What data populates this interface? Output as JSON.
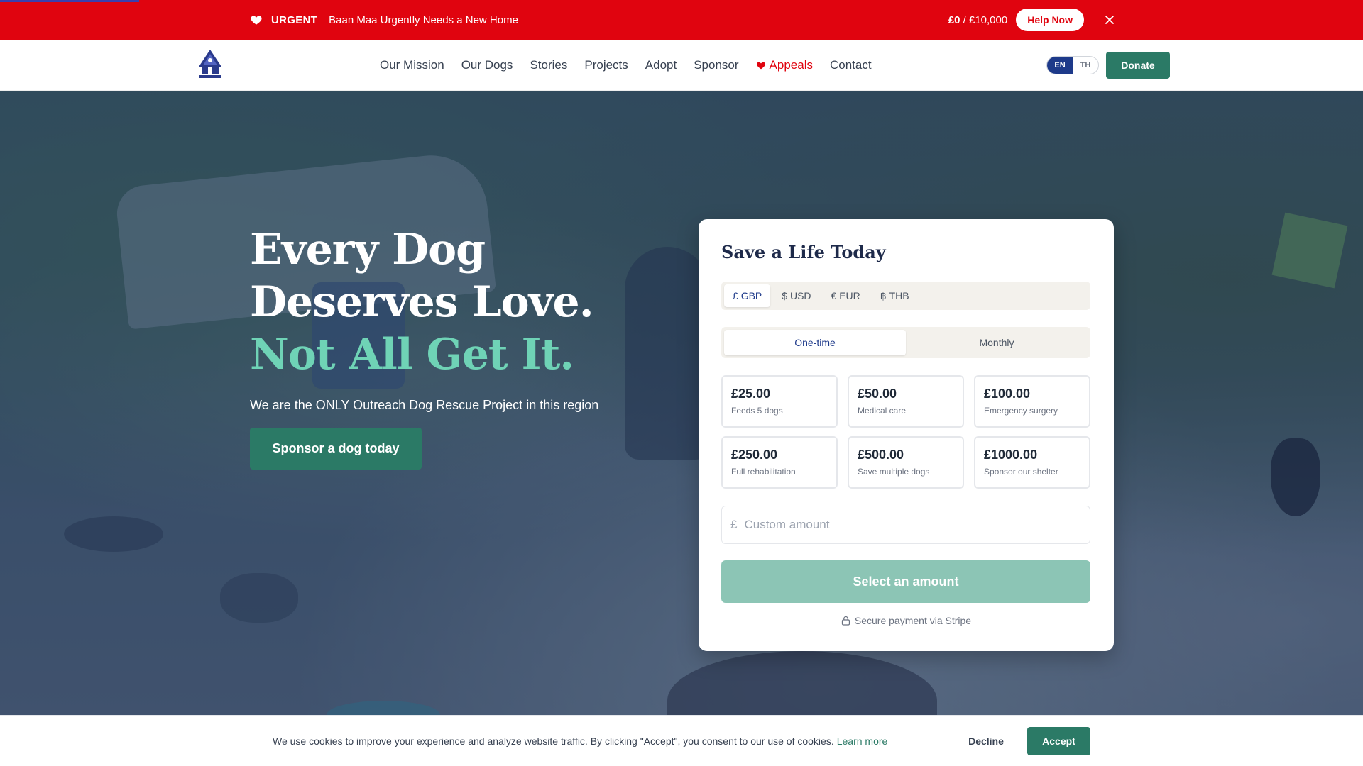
{
  "urgent_bar": {
    "tag": "URGENT",
    "message": "Baan Maa Urgently Needs a New Home",
    "raised": "£0",
    "goal": " / £10,000",
    "help_label": "Help Now",
    "heart_icon": "heart-icon",
    "close_icon": "close-icon"
  },
  "navbar": {
    "logo_icon": "baan-maa-logo",
    "links": [
      "Our Mission",
      "Our Dogs",
      "Stories",
      "Projects",
      "Adopt",
      "Sponsor"
    ],
    "appeals_label": "Appeals",
    "contact_label": "Contact",
    "lang": [
      "EN",
      "TH"
    ],
    "lang_selected": "EN",
    "donate_label": "Donate"
  },
  "hero": {
    "title_line1": "Every Dog",
    "title_line2": "Deserves Love.",
    "title_accent": "Not All Get It.",
    "subtitle": "We are the ONLY Outreach Dog Rescue Project in this region",
    "cta_label": "Sponsor a dog today"
  },
  "donation": {
    "title": "Save a Life Today",
    "currencies": [
      {
        "symbol": "£",
        "code": "GBP"
      },
      {
        "symbol": "$",
        "code": "USD"
      },
      {
        "symbol": "€",
        "code": "EUR"
      },
      {
        "symbol": "฿",
        "code": "THB"
      }
    ],
    "currency_selected": "GBP",
    "frequency": [
      "One-time",
      "Monthly"
    ],
    "frequency_selected": "One-time",
    "amounts": [
      {
        "value": "£25.00",
        "desc": "Feeds 5 dogs"
      },
      {
        "value": "£50.00",
        "desc": "Medical care"
      },
      {
        "value": "£100.00",
        "desc": "Emergency surgery"
      },
      {
        "value": "£250.00",
        "desc": "Full rehabilitation"
      },
      {
        "value": "£500.00",
        "desc": "Save multiple dogs"
      },
      {
        "value": "£1000.00",
        "desc": "Sponsor our shelter"
      }
    ],
    "custom_symbol": "£",
    "custom_placeholder": "Custom amount",
    "submit_label": "Select an amount",
    "secure_text": "Secure payment via Stripe",
    "lock_icon": "lock-icon"
  },
  "cookie": {
    "text": "We use cookies to improve your experience and analyze website traffic. By clicking \"Accept\", you consent to our use of cookies.",
    "learn_more": "Learn more",
    "decline_label": "Decline",
    "accept_label": "Accept"
  },
  "colors": {
    "urgent_red": "#e0040f",
    "brand_green": "#2b7a66",
    "accent_mint": "#6fd3b6",
    "navy": "#1e3a8a"
  }
}
